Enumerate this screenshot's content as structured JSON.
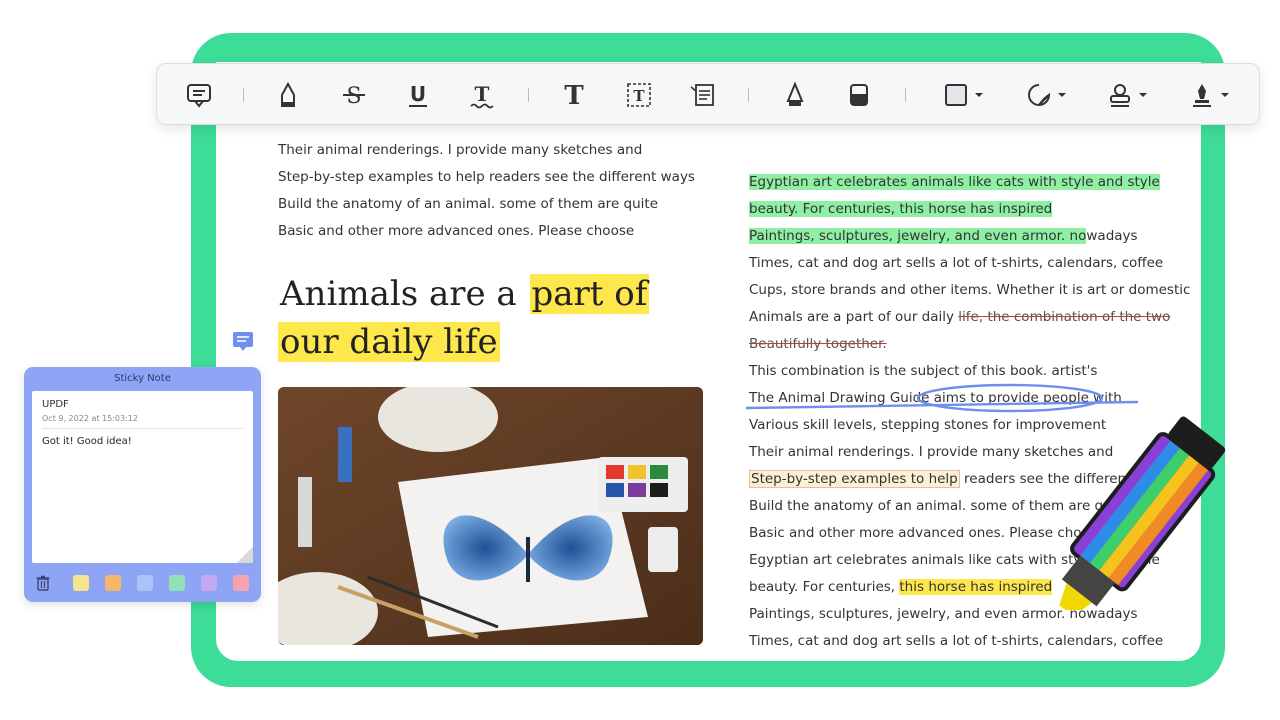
{
  "toolbar": {
    "tools": [
      {
        "id": "comment",
        "icon": "comment-icon"
      },
      {
        "id": "highlight",
        "icon": "highlighter-icon"
      },
      {
        "id": "strikethrough",
        "icon": "strikethrough-icon"
      },
      {
        "id": "underline",
        "icon": "underline-icon"
      },
      {
        "id": "squiggly",
        "icon": "squiggly-underline-icon"
      },
      {
        "id": "text",
        "icon": "text-icon"
      },
      {
        "id": "textbox",
        "icon": "text-box-icon"
      },
      {
        "id": "text-callout",
        "icon": "text-callout-icon"
      },
      {
        "id": "pencil",
        "icon": "pencil-icon"
      },
      {
        "id": "eraser",
        "icon": "eraser-icon"
      },
      {
        "id": "shape",
        "icon": "rectangle-icon"
      },
      {
        "id": "sticker",
        "icon": "sticker-icon"
      },
      {
        "id": "stamp",
        "icon": "stamp-icon"
      },
      {
        "id": "signature",
        "icon": "signature-icon"
      }
    ]
  },
  "left_column": {
    "lines": [
      "Their animal renderings. I provide many sketches and",
      "Step-by-step examples to help readers see the different ways",
      "Build the anatomy of an animal. some of them are quite",
      "Basic and other more advanced ones. Please choose"
    ],
    "heading_part1": "Animals are a ",
    "heading_hl1": "part of",
    "heading_hl2": "our daily life"
  },
  "right_column": {
    "l1": "Egyptian art celebrates animals like cats with style and style",
    "l2": "beauty. For centuries, this horse has inspired",
    "l3_hl": "Paintings, sculptures, jewelry, and even armor. no",
    "l3_rest": "wadays",
    "l4": "Times, cat and dog art sells a lot of t-shirts, calendars, coffee",
    "l5": "Cups, store brands and other items. Whether it is art or domestic",
    "l6_plain": "Animals are a part of our daily ",
    "l6_strike": "life, the combination of the two",
    "l7_strike": "Beautifully together.",
    "l8": "This combination is the subject of this book. artist's",
    "l9_plain": "The Animal Drawing Guide ",
    "l9_circled": "aims to provide people with",
    "l10": "Various skill levels, stepping stones for improvement",
    "l11": "Their animal renderings. I provide many sketches and",
    "l12_box": "Step-by-step examples to help",
    "l12_rest": " readers see the different ways",
    "l13": "Build the anatomy of an animal. some of them are quite",
    "l14": "Basic and other more advanced ones. Please choose",
    "l15": "Egyptian art celebrates animals like cats with style and style",
    "l16_plain": "beauty. For centuries, ",
    "l16_hl": "this horse has inspired",
    "l17": "Paintings, sculptures, jewelry, and even armor. nowadays",
    "l18": "Times, cat and dog art sells a lot of t-shirts, calendars, coffee"
  },
  "sticky_note": {
    "title": "Sticky Note",
    "author": "UPDF",
    "timestamp": "Oct 9, 2022 at 15:03:12",
    "body": "Got it!  Good idea!",
    "colors": [
      "#f7e58e",
      "#f5b769",
      "#a9c4f7",
      "#8fe3b4",
      "#c6a9f2",
      "#f5a3b0"
    ]
  },
  "colors": {
    "frame": "#3ddc97",
    "highlight_green": "#8ff0a4",
    "highlight_yellow": "#fde74c",
    "sticky_bg": "#8ea5f5"
  }
}
